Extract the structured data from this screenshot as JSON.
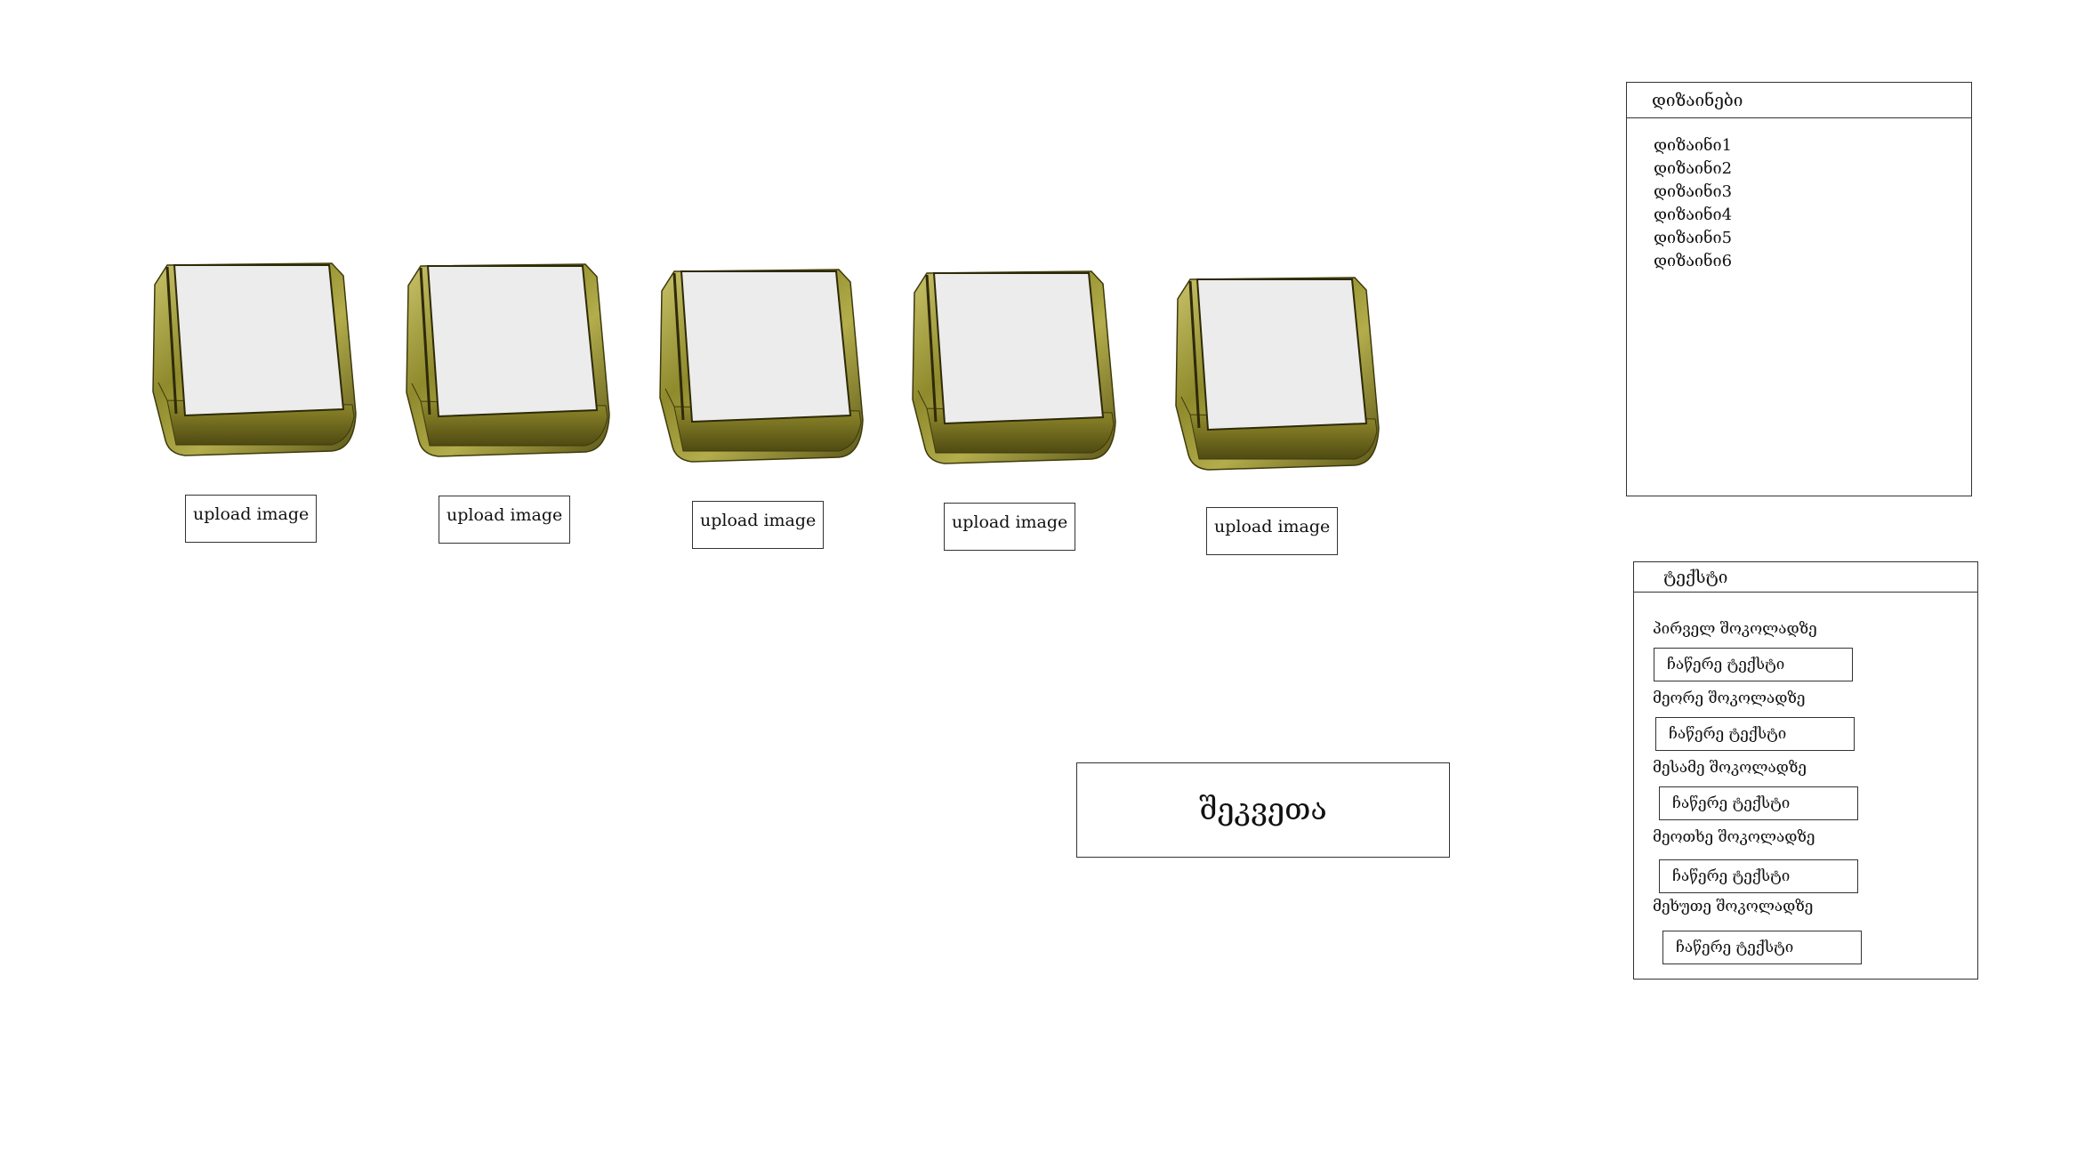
{
  "chocolates": [
    {
      "upload_label": "upload image"
    },
    {
      "upload_label": "upload image"
    },
    {
      "upload_label": "upload image"
    },
    {
      "upload_label": "upload image"
    },
    {
      "upload_label": "upload image"
    }
  ],
  "designs_panel": {
    "title": "დიზაინები",
    "items": [
      "დიზაინი1",
      "დიზაინი2",
      "დიზაინი3",
      "დიზაინი4",
      "დიზაინი5",
      "დიზაინი6"
    ]
  },
  "text_panel": {
    "title": "ტექსტი",
    "fields": [
      {
        "label": "პირველ შოკოლადზე",
        "placeholder": "ჩაწერე ტექსტი"
      },
      {
        "label": "მეორე შოკოლადზე",
        "placeholder": "ჩაწერე ტექსტი"
      },
      {
        "label": "მესამე შოკოლადზე",
        "placeholder": "ჩაწერე ტექსტი"
      },
      {
        "label": "მეოთხე შოკოლადზე",
        "placeholder": "ჩაწერე ტექსტი"
      },
      {
        "label": "მეხუთე შოკოლადზე",
        "placeholder": "ჩაწერე ტექსტი"
      }
    ]
  },
  "order_button": {
    "label": "შეკვეთა"
  },
  "colors": {
    "foil_gold": "#8f8a2c",
    "foil_light": "#c9c26a",
    "foil_dark": "#4f4a12",
    "label_face": "#ececec"
  }
}
